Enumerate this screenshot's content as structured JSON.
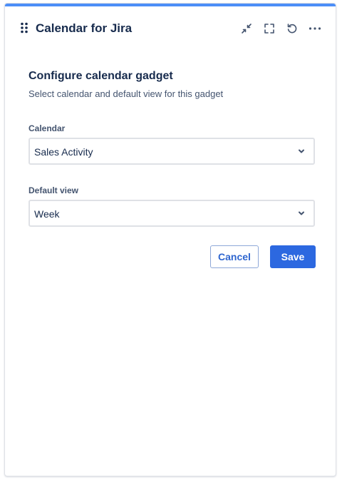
{
  "gadget": {
    "title": "Calendar for Jira",
    "accent_color": "#4c8ef7",
    "header_icons": [
      "minimize-icon",
      "fullscreen-icon",
      "refresh-icon",
      "more-icon"
    ]
  },
  "form": {
    "title": "Configure calendar gadget",
    "subtitle": "Select calendar and default view for this gadget",
    "calendar_label": "Calendar",
    "calendar_value": "Sales Activity",
    "default_view_label": "Default view",
    "default_view_value": "Week",
    "cancel_label": "Cancel",
    "save_label": "Save",
    "primary_color": "#2c68e0"
  }
}
